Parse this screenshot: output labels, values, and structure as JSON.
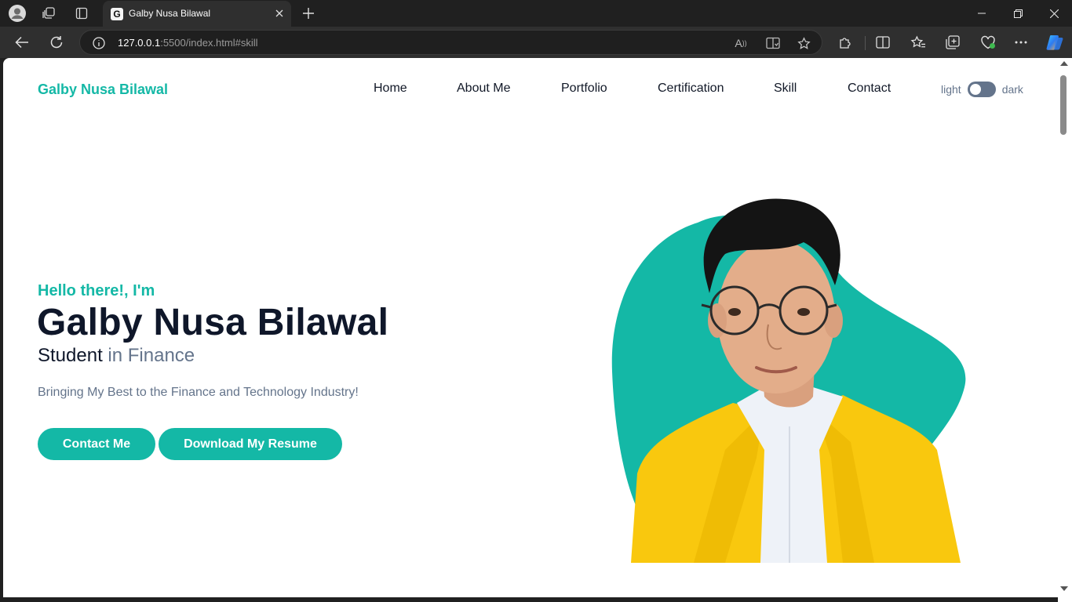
{
  "browser": {
    "tab_title": "Galby Nusa Bilawal",
    "tab_favicon": "G",
    "address_host": "127.0.0.1",
    "address_rest": ":5500/index.html#skill",
    "icons": [
      "profile-icon",
      "workspaces-icon",
      "tab-actions-icon",
      "close-tab-icon",
      "new-tab-icon",
      "minimize-icon",
      "restore-icon",
      "close-window-icon",
      "back-icon",
      "refresh-icon",
      "site-info-icon",
      "read-aloud-icon",
      "immersive-reader-icon",
      "favorite-star-icon",
      "extensions-icon",
      "split-screen-icon",
      "favorites-icon",
      "collections-icon",
      "browser-essentials-icon",
      "more-icon",
      "copilot-icon"
    ]
  },
  "header": {
    "brand": "Galby Nusa Bilawal",
    "menu": [
      "Home",
      "About Me",
      "Portfolio",
      "Certification",
      "Skill",
      "Contact"
    ],
    "theme_toggle": {
      "light_label": "light",
      "dark_label": "dark",
      "state": "light"
    }
  },
  "hero": {
    "greeting": "Hello there!, I'm",
    "name": "Galby Nusa Bilawal",
    "role_main": "Student",
    "role_accent": "in Finance",
    "tagline": "Bringing My Best to the Finance and Technology Industry!",
    "buttons": {
      "contact": "Contact Me",
      "resume": "Download My Resume"
    }
  },
  "colors": {
    "accent": "#14b8a6",
    "heading": "#0f172a",
    "muted": "#64748b",
    "jacket": "#f9c80e"
  }
}
